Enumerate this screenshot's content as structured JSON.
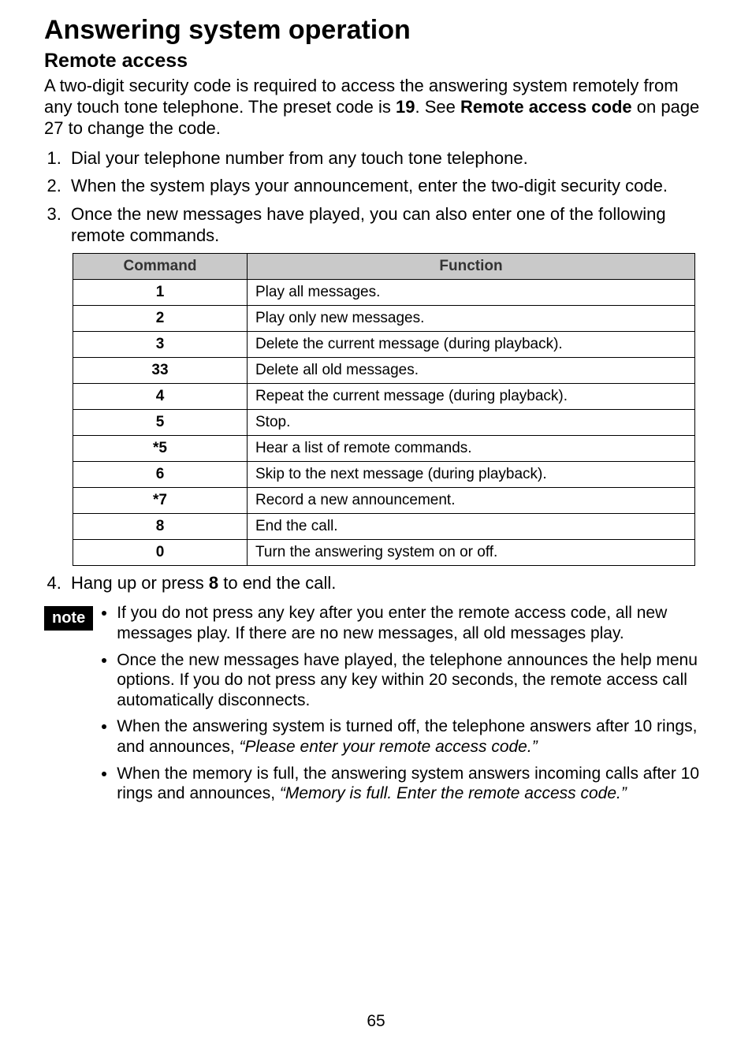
{
  "title": "Answering system operation",
  "subtitle": "Remote access",
  "intro_parts": {
    "t1": "A two-digit security code is required to access the answering system remotely from any touch tone telephone. The preset code is ",
    "code": "19",
    "t2": ". See ",
    "bold2": "Remote access code",
    "t3": " on page 27 to change the code."
  },
  "steps": {
    "s1": "Dial your telephone number from any touch tone telephone.",
    "s2": "When the system plays your announcement, enter the two-digit security code.",
    "s3": "Once the new messages have played, you can also enter one of the following remote commands."
  },
  "table": {
    "headers": {
      "command": "Command",
      "function": "Function"
    },
    "rows": [
      {
        "cmd": "1",
        "fn": "Play all messages."
      },
      {
        "cmd": "2",
        "fn": "Play only new messages."
      },
      {
        "cmd": "3",
        "fn": "Delete the current message (during playback)."
      },
      {
        "cmd": "33",
        "fn": "Delete all old messages."
      },
      {
        "cmd": "4",
        "fn": "Repeat the current message (during playback)."
      },
      {
        "cmd": "5",
        "fn": "Stop."
      },
      {
        "cmd": "*5",
        "fn": "Hear a list of remote commands."
      },
      {
        "cmd": "6",
        "fn": "Skip to the next message (during playback)."
      },
      {
        "cmd": "*7",
        "fn": "Record a new announcement."
      },
      {
        "cmd": "8",
        "fn": "End the call."
      },
      {
        "cmd": "0",
        "fn": "Turn the answering system on or off."
      }
    ]
  },
  "step4_parts": {
    "pre": "Hang up or press ",
    "bold": "8",
    "post": " to end the call."
  },
  "note_badge": "note",
  "notes": {
    "n1": "If you do not press any key after you enter the remote access code, all new messages play. If there are no new messages, all old messages play.",
    "n2": "Once the new messages have played, the telephone announces the help menu options. If you do not press any key within 20 seconds, the remote access call automatically disconnects.",
    "n3_pre": "When the answering system is turned off, the telephone answers after 10 rings, and announces, ",
    "n3_quote": "“Please enter your remote access code.”",
    "n4_pre": "When the memory is full, the answering system answers incoming calls after 10 rings and announces, ",
    "n4_quote": "“Memory is full. Enter the remote access code.”"
  },
  "page_number": "65"
}
